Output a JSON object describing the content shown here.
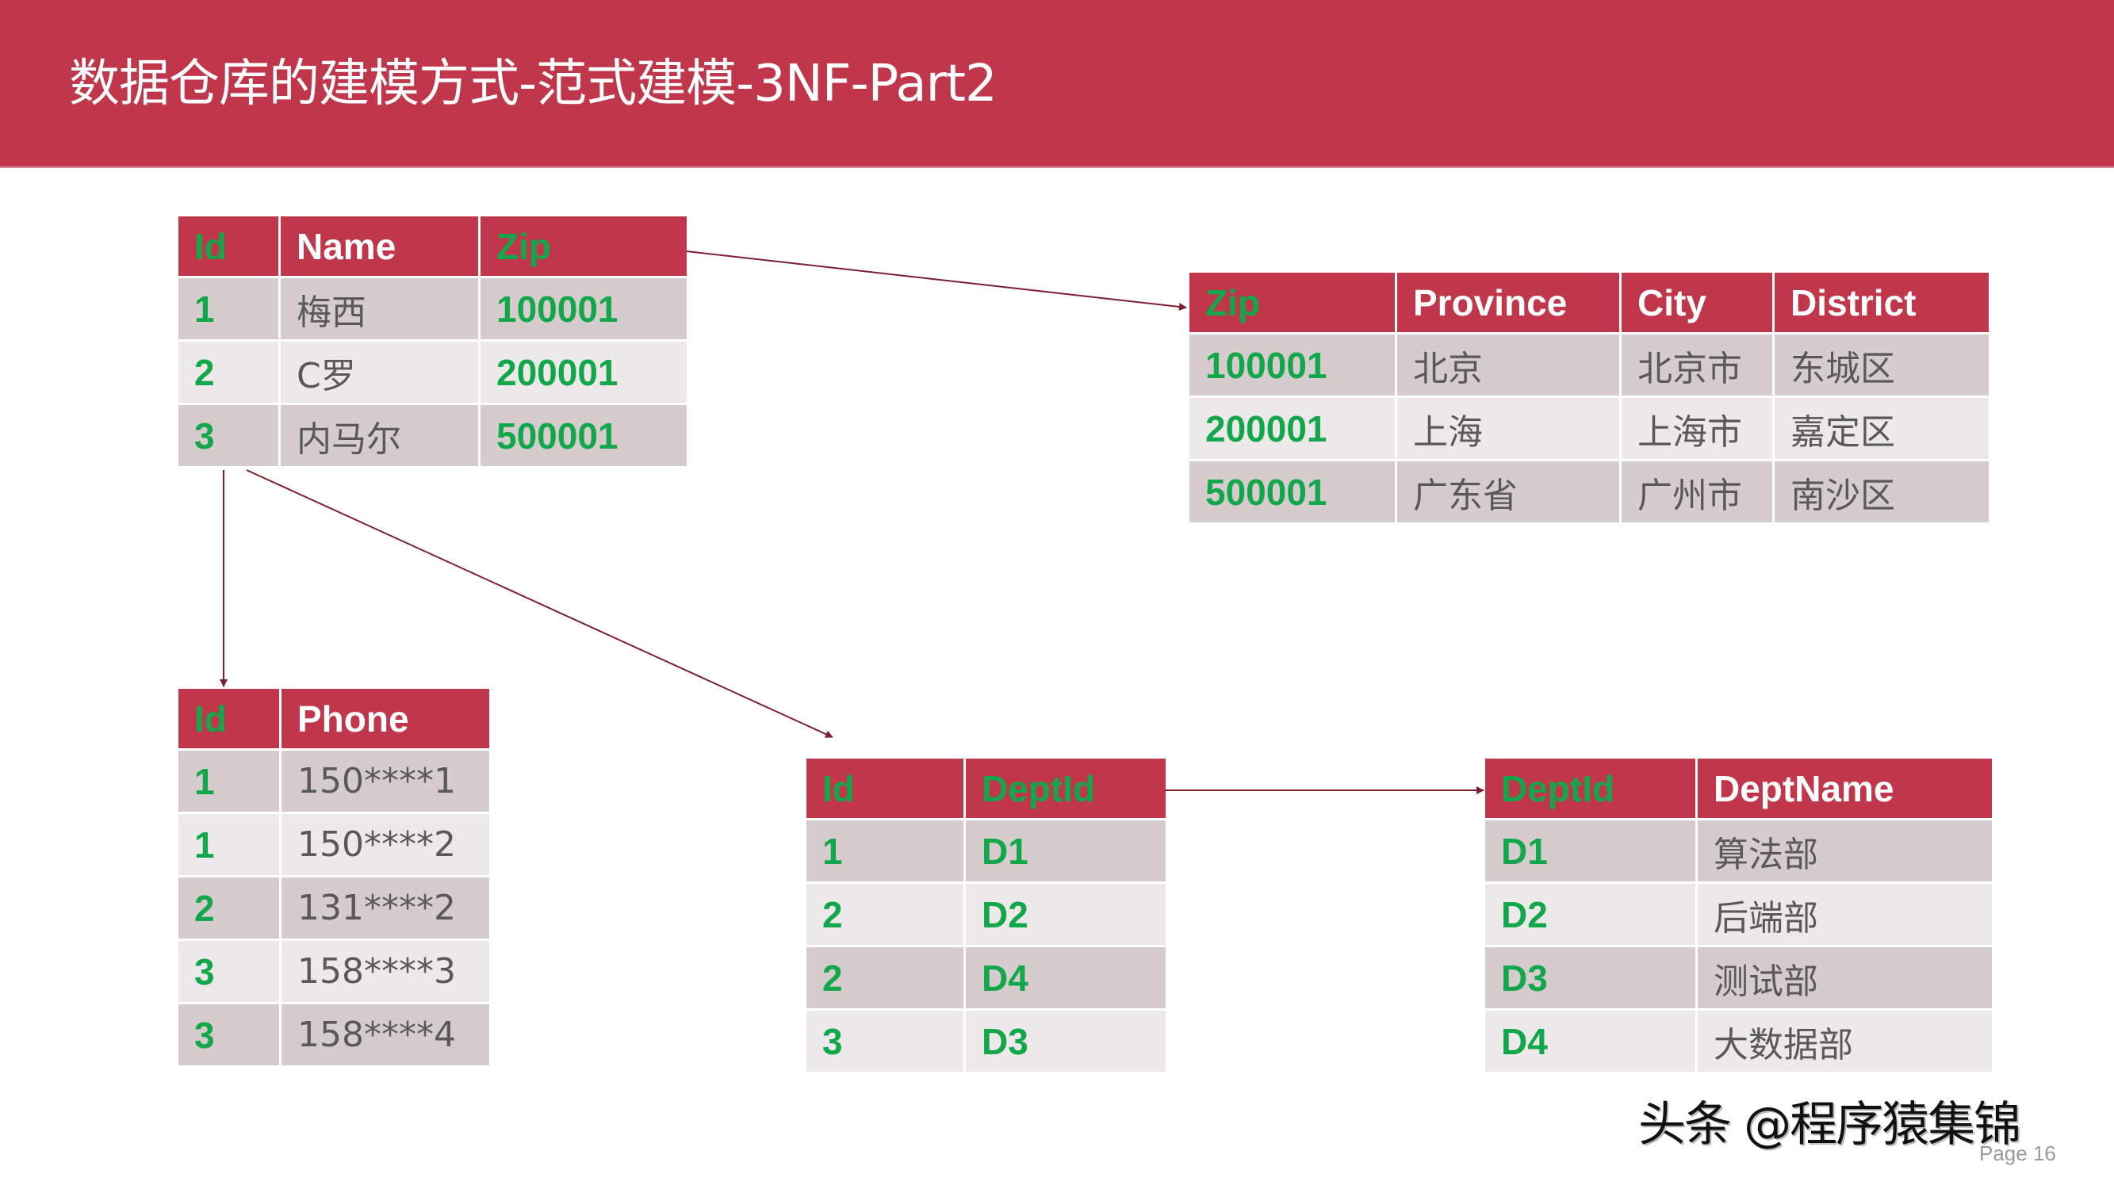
{
  "slide": {
    "title": "数据仓库的建模方式-范式建模-3NF-Part2",
    "watermark": "头条 @程序猿集锦",
    "page_label": "Page 16"
  },
  "colors": {
    "brand_red": "#C0364B",
    "key_green": "#13A74C",
    "row_dark": "#D7CCCD",
    "row_light": "#EDE8E9",
    "arrow": "#7F1E2E",
    "body_text": "#595959"
  },
  "tables": {
    "person": {
      "columns": [
        {
          "label": "Id",
          "key": true
        },
        {
          "label": "Name",
          "key": false
        },
        {
          "label": "Zip",
          "key": true
        }
      ],
      "rows": [
        [
          "1",
          "梅西",
          "100001"
        ],
        [
          "2",
          "C罗",
          "200001"
        ],
        [
          "3",
          "内马尔",
          "500001"
        ]
      ]
    },
    "zip": {
      "columns": [
        {
          "label": "Zip",
          "key": true
        },
        {
          "label": "Province",
          "key": false
        },
        {
          "label": "City",
          "key": false
        },
        {
          "label": "District",
          "key": false
        }
      ],
      "rows": [
        [
          "100001",
          "北京",
          "北京市",
          "东城区"
        ],
        [
          "200001",
          "上海",
          "上海市",
          "嘉定区"
        ],
        [
          "500001",
          "广东省",
          "广州市",
          "南沙区"
        ]
      ]
    },
    "phone": {
      "columns": [
        {
          "label": "Id",
          "key": true
        },
        {
          "label": "Phone",
          "key": false
        }
      ],
      "rows": [
        [
          "1",
          "150****1"
        ],
        [
          "1",
          "150****2"
        ],
        [
          "2",
          "131****2"
        ],
        [
          "3",
          "158****3"
        ],
        [
          "3",
          "158****4"
        ]
      ]
    },
    "person_dept": {
      "columns": [
        {
          "label": "Id",
          "key": true
        },
        {
          "label": "DeptId",
          "key": true
        }
      ],
      "rows": [
        [
          "1",
          "D1"
        ],
        [
          "2",
          "D2"
        ],
        [
          "2",
          "D4"
        ],
        [
          "3",
          "D3"
        ]
      ]
    },
    "dept": {
      "columns": [
        {
          "label": "DeptId",
          "key": true
        },
        {
          "label": "DeptName",
          "key": false
        }
      ],
      "rows": [
        [
          "D1",
          "算法部"
        ],
        [
          "D2",
          "后端部"
        ],
        [
          "D3",
          "测试部"
        ],
        [
          "D4",
          "大数据部"
        ]
      ]
    }
  },
  "relations": [
    {
      "from": "person.Zip",
      "to": "zip.Zip"
    },
    {
      "from": "person.Id",
      "to": "phone.Id"
    },
    {
      "from": "person.Id",
      "to": "person_dept.Id"
    },
    {
      "from": "person_dept.DeptId",
      "to": "dept.DeptId"
    }
  ]
}
